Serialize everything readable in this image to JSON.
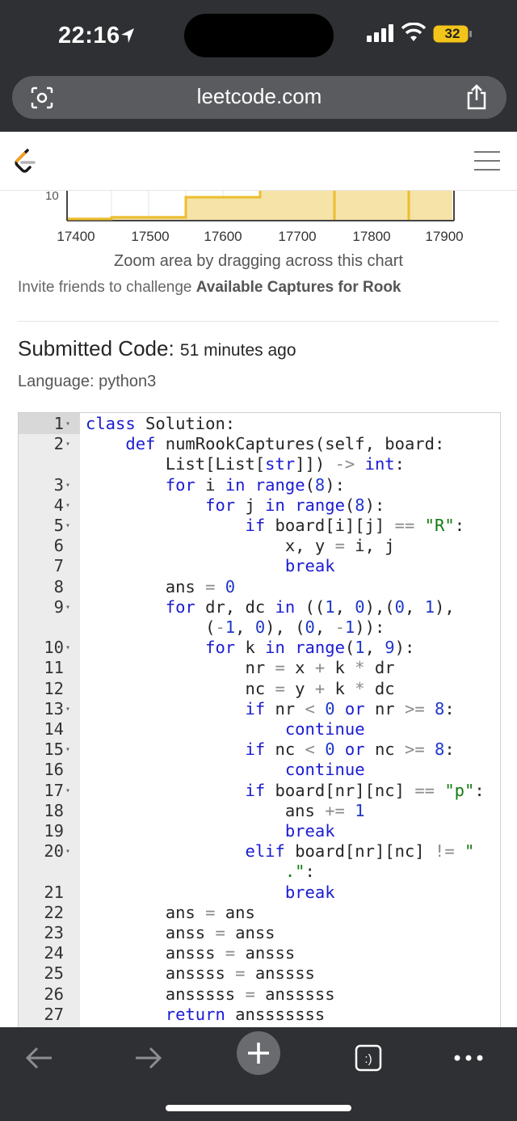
{
  "status_bar": {
    "time": "22:16",
    "battery": "32"
  },
  "browser": {
    "url": "leetcode.com"
  },
  "chart": {
    "tick_labels": [
      "17400",
      "17500",
      "17600",
      "17700",
      "17800",
      "17900"
    ],
    "y_label_visible": "10",
    "zoom_note": "Zoom area by dragging across this chart"
  },
  "invite": {
    "prefix": "Invite friends to challenge",
    "problem": "Available Captures for Rook"
  },
  "submission": {
    "heading": "Submitted Code:",
    "time_ago": "51 minutes ago",
    "language": "Language: python3"
  },
  "code_lines": [
    {
      "n": "1",
      "fold": true,
      "html": "<span class='kw'>class</span> Solution:"
    },
    {
      "n": "2",
      "fold": true,
      "html": "    <span class='kw'>def</span> numRookCaptures(self, board:"
    },
    {
      "n": "",
      "fold": false,
      "html": "        List[List[<span class='kw'>str</span>]]) <span class='op'>-&gt;</span> <span class='kw'>int</span>:"
    },
    {
      "n": "3",
      "fold": true,
      "html": "        <span class='kw'>for</span> i <span class='kw'>in</span> <span class='kw'>range</span>(<span class='num'>8</span>):"
    },
    {
      "n": "4",
      "fold": true,
      "html": "            <span class='kw'>for</span> j <span class='kw'>in</span> <span class='kw'>range</span>(<span class='num'>8</span>):"
    },
    {
      "n": "5",
      "fold": true,
      "html": "                <span class='kw'>if</span> board[i][j] <span class='op'>==</span> <span class='str'>\"R\"</span>:"
    },
    {
      "n": "6",
      "fold": false,
      "html": "                    x, y <span class='op'>=</span> i, j"
    },
    {
      "n": "7",
      "fold": false,
      "html": "                    <span class='kw'>break</span>"
    },
    {
      "n": "8",
      "fold": false,
      "html": "        ans <span class='op'>=</span> <span class='num'>0</span>"
    },
    {
      "n": "9",
      "fold": true,
      "html": "        <span class='kw'>for</span> dr, dc <span class='kw'>in</span> ((<span class='num'>1</span>, <span class='num'>0</span>),(<span class='num'>0</span>, <span class='num'>1</span>),"
    },
    {
      "n": "",
      "fold": false,
      "html": "            (<span class='op'>-</span><span class='num'>1</span>, <span class='num'>0</span>), (<span class='num'>0</span>, <span class='op'>-</span><span class='num'>1</span>)):"
    },
    {
      "n": "10",
      "fold": true,
      "html": "            <span class='kw'>for</span> k <span class='kw'>in</span> <span class='kw'>range</span>(<span class='num'>1</span>, <span class='num'>9</span>):"
    },
    {
      "n": "11",
      "fold": false,
      "html": "                nr <span class='op'>=</span> x <span class='op'>+</span> k <span class='op'>*</span> dr"
    },
    {
      "n": "12",
      "fold": false,
      "html": "                nc <span class='op'>=</span> y <span class='op'>+</span> k <span class='op'>*</span> dc"
    },
    {
      "n": "13",
      "fold": true,
      "html": "                <span class='kw'>if</span> nr <span class='op'>&lt;</span> <span class='num'>0</span> <span class='kw'>or</span> nr <span class='op'>&gt;=</span> <span class='num'>8</span>:"
    },
    {
      "n": "14",
      "fold": false,
      "html": "                    <span class='kw'>continue</span>"
    },
    {
      "n": "15",
      "fold": true,
      "html": "                <span class='kw'>if</span> nc <span class='op'>&lt;</span> <span class='num'>0</span> <span class='kw'>or</span> nc <span class='op'>&gt;=</span> <span class='num'>8</span>:"
    },
    {
      "n": "16",
      "fold": false,
      "html": "                    <span class='kw'>continue</span>"
    },
    {
      "n": "17",
      "fold": true,
      "html": "                <span class='kw'>if</span> board[nr][nc] <span class='op'>==</span> <span class='str'>\"p\"</span>:"
    },
    {
      "n": "18",
      "fold": false,
      "html": "                    ans <span class='op'>+=</span> <span class='num'>1</span>"
    },
    {
      "n": "19",
      "fold": false,
      "html": "                    <span class='kw'>break</span>"
    },
    {
      "n": "20",
      "fold": true,
      "html": "                <span class='kw'>elif</span> board[nr][nc] <span class='op'>!=</span> <span class='str'>\"</span>"
    },
    {
      "n": "",
      "fold": false,
      "html": "                    <span class='str'>.\"</span>:"
    },
    {
      "n": "21",
      "fold": false,
      "html": "                    <span class='kw'>break</span>"
    },
    {
      "n": "22",
      "fold": false,
      "html": "        ans <span class='op'>=</span> ans"
    },
    {
      "n": "23",
      "fold": false,
      "html": "        anss <span class='op'>=</span> anss"
    },
    {
      "n": "24",
      "fold": false,
      "html": "        ansss <span class='op'>=</span> ansss"
    },
    {
      "n": "25",
      "fold": false,
      "html": "        anssss <span class='op'>=</span> anssss"
    },
    {
      "n": "26",
      "fold": false,
      "html": "        ansssss <span class='op'>=</span> ansssss"
    },
    {
      "n": "27",
      "fold": false,
      "html": "        <span class='kw'>return</span> ansssssss"
    }
  ]
}
